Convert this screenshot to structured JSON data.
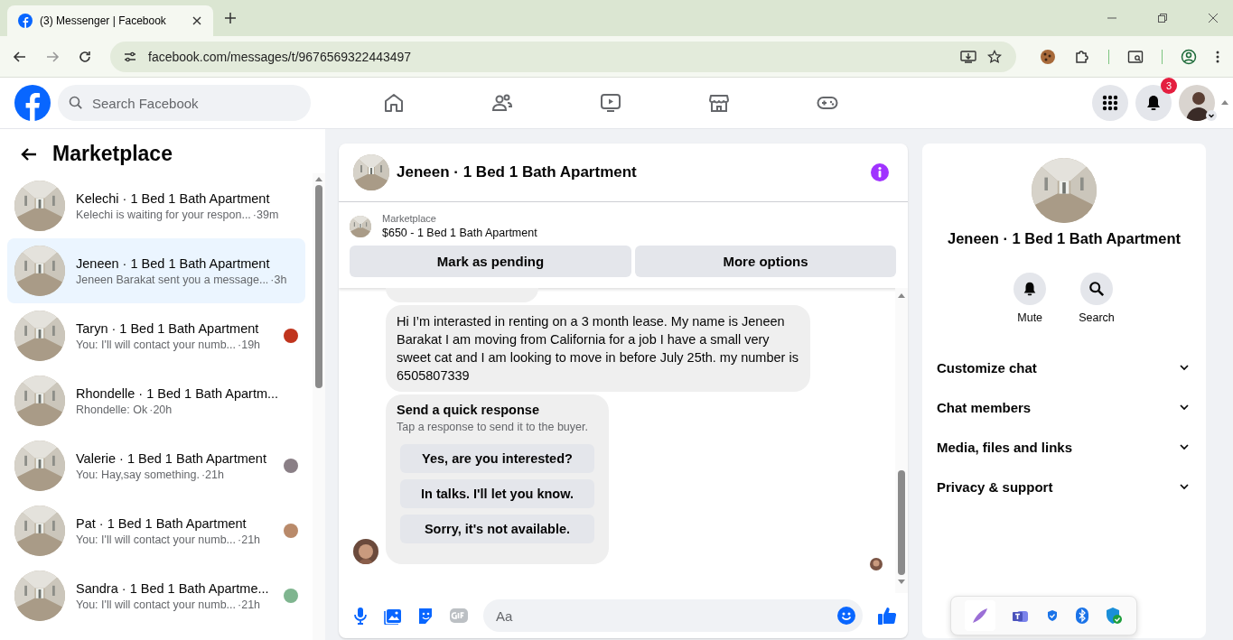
{
  "browser": {
    "tab": {
      "title": "(3) Messenger | Facebook"
    },
    "url": "facebook.com/messages/t/9676569322443497"
  },
  "header": {
    "search": {
      "placeholder": "Search Facebook"
    },
    "notification_count": "3"
  },
  "sidebar": {
    "title": "Marketplace",
    "conversations": [
      {
        "name": "Kelechi · 1 Bed 1 Bath Apartment",
        "preview": "Kelechi is waiting for your respon...",
        "time": "·39m",
        "selected": false
      },
      {
        "name": "Jeneen · 1 Bed 1 Bath Apartment",
        "preview": "Jeneen Barakat sent you a message...",
        "time": "·3h",
        "selected": true
      },
      {
        "name": "Taryn · 1 Bed 1 Bath Apartment",
        "preview": "You: I'll will contact your numb...",
        "time": "·19h",
        "selected": false,
        "color": "#c0341d"
      },
      {
        "name": "Rhondelle · 1 Bed 1 Bath Apartm...",
        "preview": "Rhondelle: Ok",
        "time": "·20h",
        "selected": false
      },
      {
        "name": "Valerie · 1 Bed 1 Bath Apartment",
        "preview": "You: Hay,say something.",
        "time": "·21h",
        "selected": false,
        "color": "#8a7f86"
      },
      {
        "name": "Pat · 1 Bed 1 Bath Apartment",
        "preview": "You: I'll will contact your numb...",
        "time": "·21h",
        "selected": false,
        "color": "#b98a6a"
      },
      {
        "name": "Sandra · 1 Bed 1 Bath Apartme...",
        "preview": "You: I'll will contact your numb...",
        "time": "·21h",
        "selected": false,
        "color": "#7fb58f"
      }
    ]
  },
  "chat": {
    "title": "Jeneen · 1 Bed 1 Bath Apartment",
    "listing": {
      "label": "Marketplace",
      "item": "$650 - 1 Bed 1 Bath Apartment"
    },
    "actions": [
      "Mark as pending",
      "More options"
    ],
    "message": "Hi I’m interasted in renting on a 3 month lease. My name is Jeneen Barakat I am moving from California for a job I have a small very sweet cat and I am looking to move in before July 25th. my number is 6505807339",
    "quick_response": {
      "title": "Send a quick response",
      "hint": "Tap a response to send it to the buyer.",
      "options": [
        "Yes, are you interested?",
        "In talks. I'll let you know.",
        "Sorry, it's not available."
      ]
    },
    "composer": {
      "placeholder": "Aa"
    }
  },
  "details": {
    "title": "Jeneen · 1 Bed 1 Bath Apartment",
    "actions": [
      {
        "kind": "mute",
        "label": "Mute"
      },
      {
        "kind": "search",
        "label": "Search"
      }
    ],
    "sections": [
      "Customize chat",
      "Chat members",
      "Media, files and links",
      "Privacy & support"
    ]
  }
}
